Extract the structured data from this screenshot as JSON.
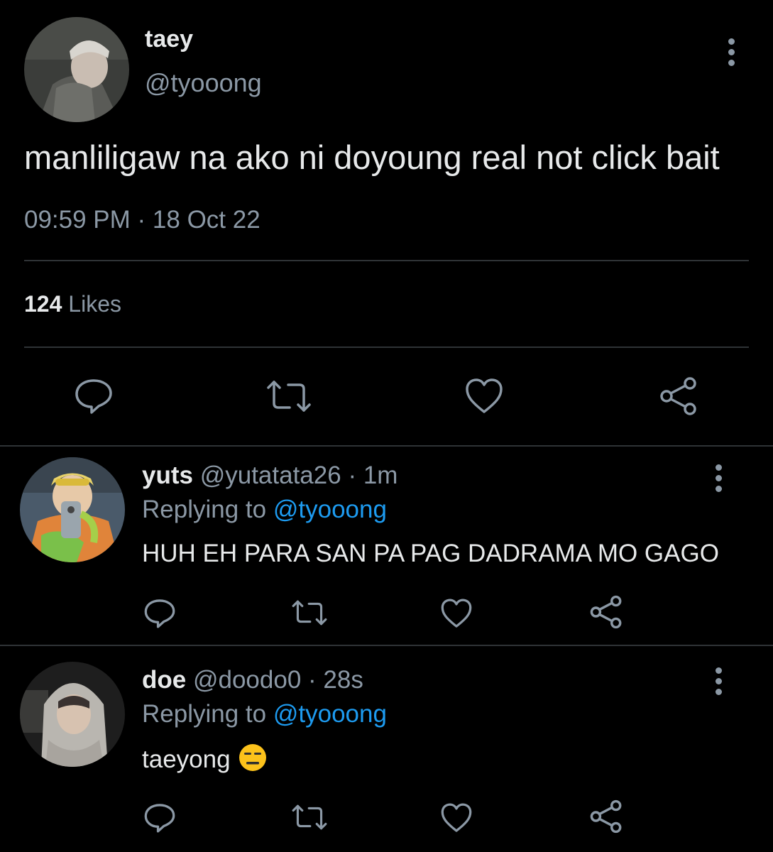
{
  "main_tweet": {
    "name": "taey",
    "handle": "@tyooong",
    "text": "manliligaw na ako ni doyoung real not click bait",
    "timestamp": "09:59 PM · 18 Oct 22",
    "likes_count": "124",
    "likes_label": "Likes"
  },
  "replies": [
    {
      "name": "yuts",
      "handle": "@yutatata26",
      "time": "· 1m",
      "replying_prefix": "Replying to",
      "replying_handle": "@tyooong",
      "text": "HUH EH PARA SAN PA PAG DADRAMA MO GAGO"
    },
    {
      "name": "doe",
      "handle": "@doodo0",
      "time": "· 28s",
      "replying_prefix": "Replying to",
      "replying_handle": "@tyooong",
      "text": "taeyong",
      "emoji": "expressionless-face-emoji"
    }
  ],
  "icons": [
    "more-icon",
    "reply-icon",
    "retweet-icon",
    "like-icon",
    "share-icon"
  ],
  "colors": {
    "background": "#000000",
    "primary_text": "#e7e9ea",
    "secondary_text": "#8b98a5",
    "link": "#1d9bf0",
    "divider": "#2f3336"
  }
}
